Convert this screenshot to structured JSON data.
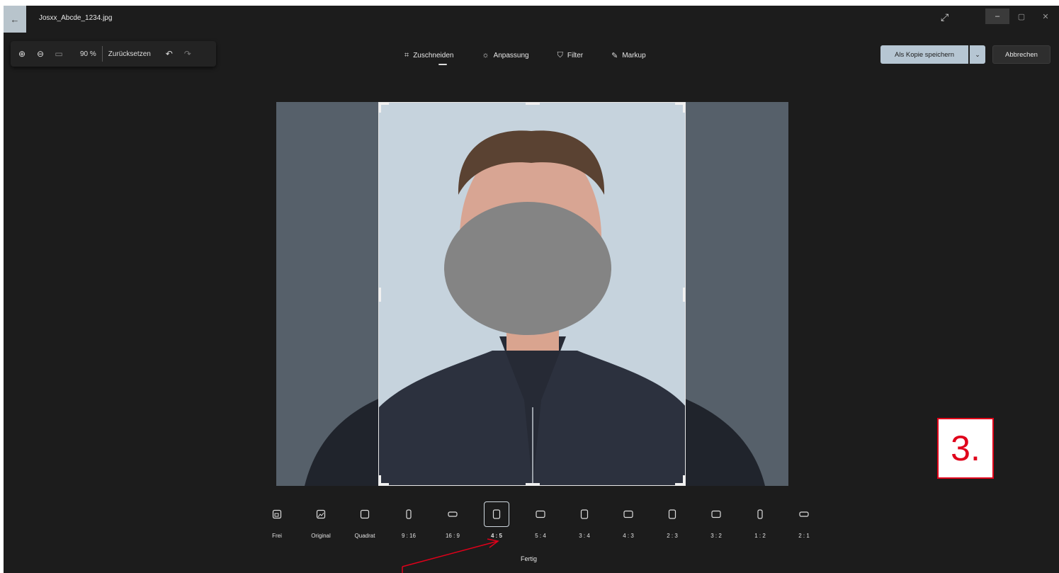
{
  "window": {
    "filename": "Josxx_Abcde_1234.jpg",
    "back_glyph": "←",
    "expand_glyph": "⤢",
    "minimize_glyph": "–",
    "maximize_glyph": "▢",
    "close_glyph": "✕"
  },
  "toolbar_left": {
    "zoom_in_glyph": "⊕",
    "zoom_out_glyph": "⊖",
    "fit_glyph": "▭",
    "zoom": "90 %",
    "reset": "Zurücksetzen",
    "undo_glyph": "↶",
    "redo_glyph": "↷"
  },
  "tabs": [
    {
      "label": "Zuschneiden",
      "icon": "crop-icon",
      "glyph": "⌗"
    },
    {
      "label": "Anpassung",
      "icon": "brightness-icon",
      "glyph": "☼"
    },
    {
      "label": "Filter",
      "icon": "filter-icon",
      "glyph": "⛉"
    },
    {
      "label": "Markup",
      "icon": "pen-icon",
      "glyph": "✎"
    }
  ],
  "actions": {
    "save_copy": "Als Kopie speichern",
    "save_dropdown": "⌄",
    "cancel": "Abbrechen"
  },
  "ratios": [
    {
      "label": "Frei",
      "shape": "free"
    },
    {
      "label": "Original",
      "shape": "image"
    },
    {
      "label": "Quadrat",
      "shape": "square"
    },
    {
      "label": "9 : 16",
      "shape": "tall"
    },
    {
      "label": "16 : 9",
      "shape": "wide"
    },
    {
      "label": "4 : 5",
      "shape": "portrait",
      "selected": true
    },
    {
      "label": "5 : 4",
      "shape": "landscape"
    },
    {
      "label": "3 : 4",
      "shape": "portrait"
    },
    {
      "label": "4 : 3",
      "shape": "landscape"
    },
    {
      "label": "2 : 3",
      "shape": "portrait"
    },
    {
      "label": "3 : 2",
      "shape": "landscape"
    },
    {
      "label": "1 : 2",
      "shape": "tall"
    },
    {
      "label": "2 : 1",
      "shape": "wide"
    }
  ],
  "done": "Fertig",
  "step_label": "3.",
  "colors": {
    "accent": "#b6c6d3",
    "background": "#1c1c1c",
    "annotation": "#e0001a"
  }
}
